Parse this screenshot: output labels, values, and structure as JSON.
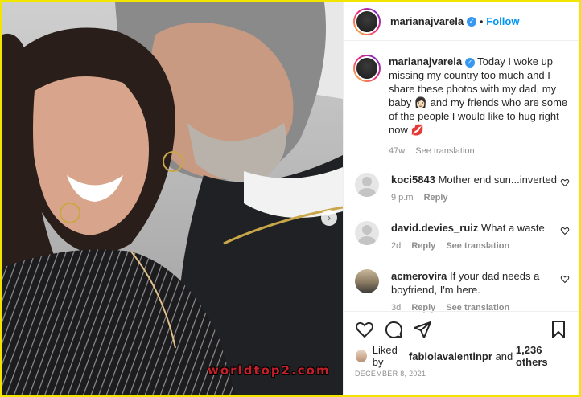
{
  "post": {
    "username": "marianajvarela",
    "follow_label": "Follow",
    "separator": "•",
    "verified_mark": "✓"
  },
  "caption": {
    "username": "marianajvarela",
    "text_1": "Today I woke up missing my country too much and I share these photos with my dad, my baby",
    "emoji_1": "👩🏻",
    "text_2": "and my friends who are some of the people I would like to hug right now",
    "emoji_2": "💋",
    "time": "47w",
    "see_translation": "See translation"
  },
  "comments": [
    {
      "username": "koci5843",
      "text": "Mother end sun...inverted",
      "time": "9 p.m",
      "reply": "Reply",
      "see_translation": ""
    },
    {
      "username": "david.devies_ruiz",
      "text": "What a waste",
      "time": "2d",
      "reply": "Reply",
      "see_translation": "See translation"
    },
    {
      "username": "acmerovira",
      "text": "If your dad needs a boyfriend, I'm here.",
      "time": "3d",
      "reply": "Reply",
      "see_translation": "See translation"
    }
  ],
  "likes": {
    "prefix": "Liked by",
    "user": "fabiolavalentinpr",
    "and": "and",
    "others": "1,236 others"
  },
  "date": "DECEMBER 8, 2021",
  "watermark": "worldtop2.com",
  "icons": {
    "like": "heart-icon",
    "comment": "comment-icon",
    "share": "share-icon",
    "save": "bookmark-icon",
    "next": "chevron-right-icon"
  },
  "colors": {
    "accent": "#0095f6",
    "verified": "#3897f0",
    "border": "#f2e600",
    "watermark": "#c8202a"
  }
}
